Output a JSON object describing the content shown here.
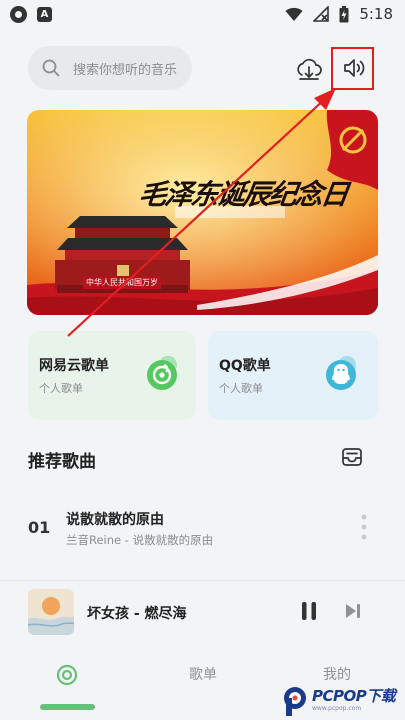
{
  "status_bar": {
    "time": "5:18",
    "notification_letter": "A"
  },
  "search": {
    "placeholder": "搜索你想听的音乐"
  },
  "banner": {
    "title": "毛泽东诞辰纪念日",
    "sign": "中华人民共和国万岁"
  },
  "cards": [
    {
      "title": "网易云歌单",
      "subtitle": "个人歌单"
    },
    {
      "title": "QQ歌单",
      "subtitle": "个人歌单"
    }
  ],
  "recommend": {
    "title": "推荐歌曲",
    "songs": [
      {
        "index": "01",
        "title": "说散就散的原由",
        "subtitle": "兰音Reine - 说散就散的原由"
      }
    ]
  },
  "player": {
    "title": "坏女孩 - 燃尽海"
  },
  "nav": {
    "playlist": "歌单",
    "mine": "我的"
  },
  "watermark": {
    "brand": "PCPOP下载",
    "sub": "www.pcpop.com"
  },
  "colors": {
    "accent_green": "#67c07a",
    "annotation_red": "#e02020",
    "card_green_bg": "#e8f4ea",
    "card_blue_bg": "#e5f1f8"
  }
}
